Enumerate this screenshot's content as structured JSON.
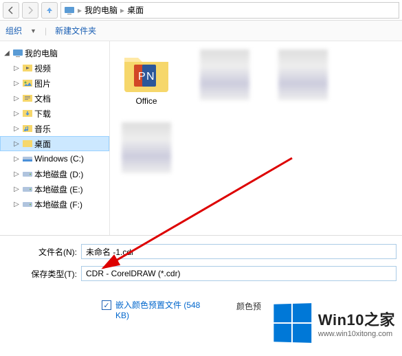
{
  "nav": {
    "back": "返回"
  },
  "breadcrumb": {
    "root": "我的电脑",
    "current": "桌面"
  },
  "toolbar": {
    "organize": "组织",
    "newFolder": "新建文件夹"
  },
  "tree": {
    "root": "我的电脑",
    "items": [
      {
        "label": "视频",
        "icon": "video"
      },
      {
        "label": "图片",
        "icon": "image"
      },
      {
        "label": "文档",
        "icon": "doc"
      },
      {
        "label": "下载",
        "icon": "download"
      },
      {
        "label": "音乐",
        "icon": "music"
      },
      {
        "label": "桌面",
        "icon": "desktop",
        "selected": true
      },
      {
        "label": "Windows (C:)",
        "icon": "drive"
      },
      {
        "label": "本地磁盘 (D:)",
        "icon": "drive"
      },
      {
        "label": "本地磁盘 (E:)",
        "icon": "drive"
      },
      {
        "label": "本地磁盘 (F:)",
        "icon": "drive"
      }
    ]
  },
  "content": {
    "items": [
      {
        "label": "Office",
        "type": "folder-ppt"
      },
      {
        "label": "",
        "type": "blur"
      },
      {
        "label": "",
        "type": "blur"
      },
      {
        "label": "",
        "type": "blur"
      }
    ]
  },
  "fields": {
    "filenameLabel": "文件名(N):",
    "filenameValue": "未命名 -1.cdr",
    "typeLabel": "保存类型(T):",
    "typeValue": "CDR - CorelDRAW (*.cdr)"
  },
  "options": {
    "embedProfile": "嵌入颜色预置文件 (548 KB)",
    "colorPreview": "颜色预"
  },
  "watermark": {
    "title": "Win10之家",
    "url": "www.win10xitong.com"
  }
}
